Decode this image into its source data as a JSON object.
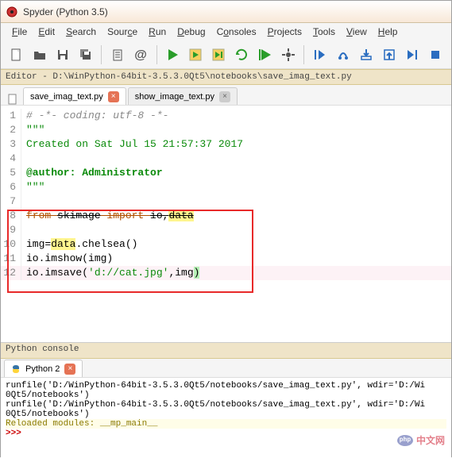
{
  "window": {
    "title": "Spyder (Python 3.5)"
  },
  "menu": {
    "file": "File",
    "edit": "Edit",
    "search": "Search",
    "source": "Source",
    "run": "Run",
    "debug": "Debug",
    "consoles": "Consoles",
    "projects": "Projects",
    "tools": "Tools",
    "view": "View",
    "help": "Help"
  },
  "toolbar_icons": {
    "new": "new-file",
    "open": "open-folder",
    "save": "save",
    "saveall": "save-all",
    "clipboard": "clipboard",
    "at": "at-sign",
    "run": "run",
    "runcell": "run-cell",
    "runcelladv": "run-cell-advance",
    "rerun": "re-run",
    "debug": "debug-continue",
    "debugcfg": "debug-config",
    "stepin": "step-in",
    "stepover": "step-over",
    "stepout": "step-out",
    "stop": "stop",
    "stepret": "step-return",
    "end": "end"
  },
  "pathbar": {
    "label": "Editor - D:\\WinPython-64bit-3.5.3.0Qt5\\notebooks\\save_imag_text.py"
  },
  "tabs": {
    "active": "save_imag_text.py",
    "inactive": "show_image_text.py"
  },
  "code": {
    "lines": [
      {
        "n": 1,
        "type": "comment",
        "text": "# -*- coding: utf-8 -*-"
      },
      {
        "n": 2,
        "type": "str",
        "text": "\"\"\""
      },
      {
        "n": 3,
        "type": "str",
        "text": "Created on Sat Jul 15 21:57:37 2017"
      },
      {
        "n": 4,
        "type": "blank",
        "text": ""
      },
      {
        "n": 5,
        "type": "deco",
        "text": "@author: Administrator"
      },
      {
        "n": 6,
        "type": "str",
        "text": "\"\"\""
      },
      {
        "n": 7,
        "type": "blank",
        "text": ""
      },
      {
        "n": 8,
        "type": "import",
        "pre": "from ",
        "mod": "skimage",
        "mid": " import ",
        "t1": "io",
        "comma": ",",
        "t2": "data"
      },
      {
        "n": 9,
        "type": "blank",
        "text": ""
      },
      {
        "n": 10,
        "type": "code",
        "a": "img=",
        "b": "data",
        "c": ".chelsea()"
      },
      {
        "n": 11,
        "type": "plain",
        "text": "io.imshow(img)"
      },
      {
        "n": 12,
        "type": "save",
        "a": "io.imsave(",
        "b": "'d://cat.jpg'",
        "c": ",img",
        "d": ")"
      }
    ]
  },
  "console": {
    "title": "Python console",
    "tab": "Python 2",
    "lines": [
      "runfile('D:/WinPython-64bit-3.5.3.0Qt5/notebooks/save_imag_text.py', wdir='D:/Wi",
      "0Qt5/notebooks')",
      "runfile('D:/WinPython-64bit-3.5.3.0Qt5/notebooks/save_imag_text.py', wdir='D:/Wi",
      "0Qt5/notebooks')"
    ],
    "reloaded": "Reloaded modules: __mp_main__",
    "prompt": ">>>"
  },
  "watermark": {
    "php": "php",
    "text": "中文网"
  },
  "colors": {
    "accent_green": "#0a8a0a",
    "accent_red": "#e82a2a",
    "hl_yellow": "#fff68f",
    "hl_green": "#b6f0b6"
  }
}
